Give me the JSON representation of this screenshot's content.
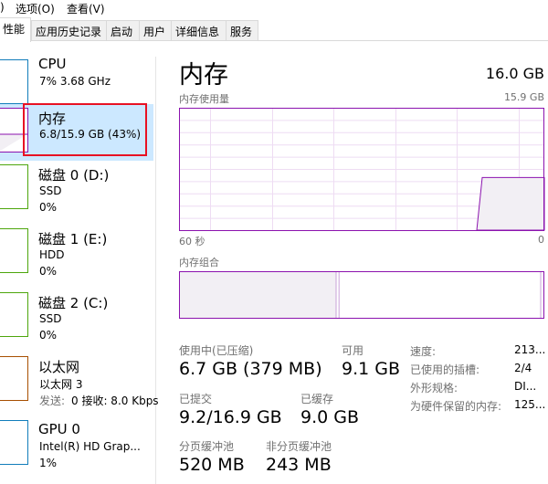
{
  "menu": {
    "items": [
      ")",
      "选项(O)",
      "查看(V)"
    ]
  },
  "tabs": [
    "性能",
    "应用历史记录",
    "启动",
    "用户",
    "详细信息",
    "服务"
  ],
  "active_tab": "性能",
  "sidebar": {
    "items": [
      {
        "title": "CPU",
        "line1": "7% 3.68 GHz",
        "line2": "",
        "color": "#117dbb"
      },
      {
        "title": "内存",
        "line1": "6.8/15.9 GB (43%)",
        "line2": "",
        "color": "#8b12ae",
        "selected": true
      },
      {
        "title": "磁盘 0 (D:)",
        "line1": "SSD",
        "line2": "0%",
        "color": "#4da60c"
      },
      {
        "title": "磁盘 1 (E:)",
        "line1": "HDD",
        "line2": "0%",
        "color": "#4da60c"
      },
      {
        "title": "磁盘 2 (C:)",
        "line1": "SSD",
        "line2": "0%",
        "color": "#4da60c"
      },
      {
        "title": "以太网",
        "line1": "以太网 3",
        "line2_label": "发送: ",
        "line2": "0 接收: 8.0 Kbps",
        "color": "#a74f01"
      },
      {
        "title": "GPU 0",
        "line1": "Intel(R) HD Grap...",
        "line2": "1%",
        "color": "#117dbb"
      }
    ]
  },
  "main": {
    "title": "内存",
    "total": "16.0 GB",
    "usage_graph": {
      "label": "内存使用量",
      "max_label": "15.9 GB",
      "x_left": "60 秒",
      "x_right": "0",
      "current_percent": 43,
      "accent": "#8b12ae"
    },
    "composition": {
      "label": "内存组合",
      "in_use_fraction": 0.43,
      "modified_fraction": 0.008,
      "standby_end_fraction": 0.99
    },
    "stats": [
      {
        "label": "使用中(已压缩)",
        "value": "6.7 GB (379 MB)"
      },
      {
        "label": "可用",
        "value": "9.1 GB"
      },
      {
        "label": "已提交",
        "value": "9.2/16.9 GB"
      },
      {
        "label": "已缓存",
        "value": "9.0 GB"
      },
      {
        "label": "分页缓冲池",
        "value": "520 MB"
      },
      {
        "label": "非分页缓冲池",
        "value": "243 MB"
      }
    ],
    "details": [
      {
        "label": "速度:",
        "value": "213..."
      },
      {
        "label": "已使用的插槽:",
        "value": "2/4"
      },
      {
        "label": "外形规格:",
        "value": "DI..."
      },
      {
        "label": "为硬件保留的内存:",
        "value": "125..."
      }
    ]
  }
}
